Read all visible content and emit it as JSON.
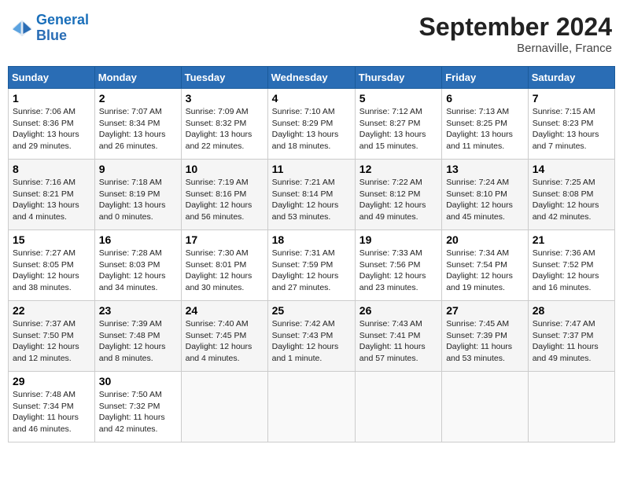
{
  "header": {
    "logo_line1": "General",
    "logo_line2": "Blue",
    "month": "September 2024",
    "location": "Bernaville, France"
  },
  "days_of_week": [
    "Sunday",
    "Monday",
    "Tuesday",
    "Wednesday",
    "Thursday",
    "Friday",
    "Saturday"
  ],
  "weeks": [
    [
      {
        "day": "1",
        "info": "Sunrise: 7:06 AM\nSunset: 8:36 PM\nDaylight: 13 hours\nand 29 minutes."
      },
      {
        "day": "2",
        "info": "Sunrise: 7:07 AM\nSunset: 8:34 PM\nDaylight: 13 hours\nand 26 minutes."
      },
      {
        "day": "3",
        "info": "Sunrise: 7:09 AM\nSunset: 8:32 PM\nDaylight: 13 hours\nand 22 minutes."
      },
      {
        "day": "4",
        "info": "Sunrise: 7:10 AM\nSunset: 8:29 PM\nDaylight: 13 hours\nand 18 minutes."
      },
      {
        "day": "5",
        "info": "Sunrise: 7:12 AM\nSunset: 8:27 PM\nDaylight: 13 hours\nand 15 minutes."
      },
      {
        "day": "6",
        "info": "Sunrise: 7:13 AM\nSunset: 8:25 PM\nDaylight: 13 hours\nand 11 minutes."
      },
      {
        "day": "7",
        "info": "Sunrise: 7:15 AM\nSunset: 8:23 PM\nDaylight: 13 hours\nand 7 minutes."
      }
    ],
    [
      {
        "day": "8",
        "info": "Sunrise: 7:16 AM\nSunset: 8:21 PM\nDaylight: 13 hours\nand 4 minutes."
      },
      {
        "day": "9",
        "info": "Sunrise: 7:18 AM\nSunset: 8:19 PM\nDaylight: 13 hours\nand 0 minutes."
      },
      {
        "day": "10",
        "info": "Sunrise: 7:19 AM\nSunset: 8:16 PM\nDaylight: 12 hours\nand 56 minutes."
      },
      {
        "day": "11",
        "info": "Sunrise: 7:21 AM\nSunset: 8:14 PM\nDaylight: 12 hours\nand 53 minutes."
      },
      {
        "day": "12",
        "info": "Sunrise: 7:22 AM\nSunset: 8:12 PM\nDaylight: 12 hours\nand 49 minutes."
      },
      {
        "day": "13",
        "info": "Sunrise: 7:24 AM\nSunset: 8:10 PM\nDaylight: 12 hours\nand 45 minutes."
      },
      {
        "day": "14",
        "info": "Sunrise: 7:25 AM\nSunset: 8:08 PM\nDaylight: 12 hours\nand 42 minutes."
      }
    ],
    [
      {
        "day": "15",
        "info": "Sunrise: 7:27 AM\nSunset: 8:05 PM\nDaylight: 12 hours\nand 38 minutes."
      },
      {
        "day": "16",
        "info": "Sunrise: 7:28 AM\nSunset: 8:03 PM\nDaylight: 12 hours\nand 34 minutes."
      },
      {
        "day": "17",
        "info": "Sunrise: 7:30 AM\nSunset: 8:01 PM\nDaylight: 12 hours\nand 30 minutes."
      },
      {
        "day": "18",
        "info": "Sunrise: 7:31 AM\nSunset: 7:59 PM\nDaylight: 12 hours\nand 27 minutes."
      },
      {
        "day": "19",
        "info": "Sunrise: 7:33 AM\nSunset: 7:56 PM\nDaylight: 12 hours\nand 23 minutes."
      },
      {
        "day": "20",
        "info": "Sunrise: 7:34 AM\nSunset: 7:54 PM\nDaylight: 12 hours\nand 19 minutes."
      },
      {
        "day": "21",
        "info": "Sunrise: 7:36 AM\nSunset: 7:52 PM\nDaylight: 12 hours\nand 16 minutes."
      }
    ],
    [
      {
        "day": "22",
        "info": "Sunrise: 7:37 AM\nSunset: 7:50 PM\nDaylight: 12 hours\nand 12 minutes."
      },
      {
        "day": "23",
        "info": "Sunrise: 7:39 AM\nSunset: 7:48 PM\nDaylight: 12 hours\nand 8 minutes."
      },
      {
        "day": "24",
        "info": "Sunrise: 7:40 AM\nSunset: 7:45 PM\nDaylight: 12 hours\nand 4 minutes."
      },
      {
        "day": "25",
        "info": "Sunrise: 7:42 AM\nSunset: 7:43 PM\nDaylight: 12 hours\nand 1 minute."
      },
      {
        "day": "26",
        "info": "Sunrise: 7:43 AM\nSunset: 7:41 PM\nDaylight: 11 hours\nand 57 minutes."
      },
      {
        "day": "27",
        "info": "Sunrise: 7:45 AM\nSunset: 7:39 PM\nDaylight: 11 hours\nand 53 minutes."
      },
      {
        "day": "28",
        "info": "Sunrise: 7:47 AM\nSunset: 7:37 PM\nDaylight: 11 hours\nand 49 minutes."
      }
    ],
    [
      {
        "day": "29",
        "info": "Sunrise: 7:48 AM\nSunset: 7:34 PM\nDaylight: 11 hours\nand 46 minutes."
      },
      {
        "day": "30",
        "info": "Sunrise: 7:50 AM\nSunset: 7:32 PM\nDaylight: 11 hours\nand 42 minutes."
      },
      null,
      null,
      null,
      null,
      null
    ]
  ]
}
